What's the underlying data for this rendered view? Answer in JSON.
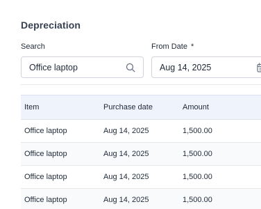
{
  "page": {
    "title": "Depreciation"
  },
  "filters": {
    "search": {
      "label": "Search",
      "value": "Office laptop",
      "icon": "search-icon"
    },
    "from_date": {
      "label": "From Date",
      "required_mark": "*",
      "value": "Aug 14, 2025",
      "icon": "calendar-icon"
    }
  },
  "table": {
    "columns": [
      "Item",
      "Purchase date",
      "Amount"
    ],
    "rows": [
      [
        "Office laptop",
        "Aug 14, 2025",
        "1,500.00"
      ],
      [
        "Office laptop",
        "Aug 14, 2025",
        "1,500.00"
      ],
      [
        "Office laptop",
        "Aug 14, 2025",
        "1,500.00"
      ],
      [
        "Office laptop",
        "Aug 14, 2025",
        "1,500.00"
      ]
    ]
  },
  "colors": {
    "header_bg": "#eef3fc",
    "border": "#d1d5db",
    "text": "#1f2937"
  }
}
